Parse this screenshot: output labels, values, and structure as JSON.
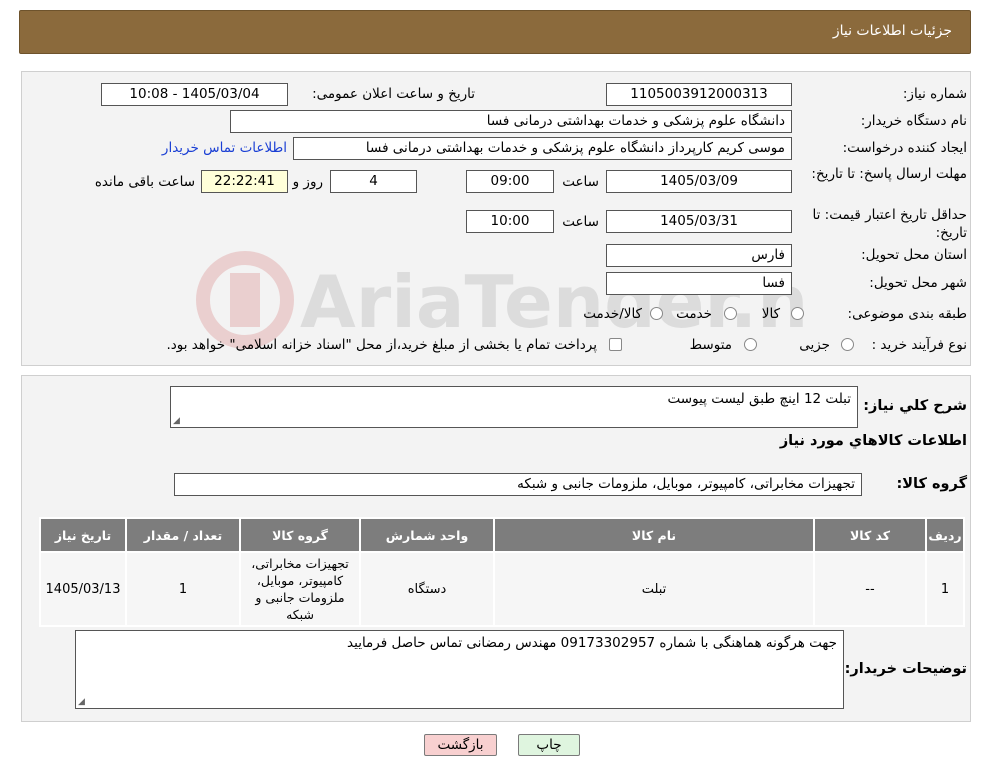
{
  "title": "جزئیات اطلاعات نیاز",
  "labels": {
    "need_number": "شماره نیاز:",
    "announce_datetime": "تاریخ و ساعت اعلان عمومی:",
    "buyer_org": "نام دستگاه خریدار:",
    "requester": "ایجاد کننده درخواست:",
    "send_deadline": "مهلت ارسال پاسخ: تا تاریخ:",
    "price_validity": "حداقل تاریخ اعتبار قیمت: تا تاریخ:",
    "province": "استان محل تحویل:",
    "city": "شهر محل تحویل:",
    "category": "طبقه بندی موضوعی:",
    "process_type": "نوع فرآیند خرید :",
    "time": "ساعت",
    "day_and": "روز و",
    "remaining": "ساعت باقی مانده",
    "description": "شرح کلي نياز:",
    "goods_info": "اطلاعات کالاهاي مورد نياز",
    "goods_group": "گروه کالا:",
    "buyer_notes": "توضیحات خریدار:"
  },
  "values": {
    "need_number": "1105003912000313",
    "announce_datetime": "1405/03/04 - 10:08",
    "buyer_org": "دانشگاه علوم پزشکی و خدمات بهداشتی درمانی فسا",
    "requester": "موسی کریم کارپرداز دانشگاه علوم پزشکی و خدمات بهداشتی درمانی فسا",
    "contact_link": "اطلاعات تماس خریدار",
    "send_date": "1405/03/09",
    "send_time": "09:00",
    "days": "4",
    "remaining_time": "22:22:41",
    "validity_date": "1405/03/31",
    "validity_time": "10:00",
    "province": "فارس",
    "city": "فسا",
    "description": "تبلت 12 اینچ طبق لیست پیوست",
    "goods_group": "تجهیزات مخابراتی، کامپیوتر، موبایل، ملزومات جانبی و شبکه",
    "buyer_notes": "جهت هرگونه هماهنگی با شماره 09173302957 مهندس رمضانی تماس حاصل فرمایید"
  },
  "category_options": [
    "کالا",
    "خدمت",
    "کالا/خدمت"
  ],
  "process_options": [
    "جزیی",
    "متوسط"
  ],
  "process_note": "پرداخت تمام یا بخشی از مبلغ خرید،از محل \"اسناد خزانه اسلامی\" خواهد بود.",
  "table": {
    "headers": [
      "ردیف",
      "کد کالا",
      "نام کالا",
      "واحد شمارش",
      "گروه کالا",
      "تعداد / مقدار",
      "تاریخ نیاز"
    ],
    "rows": [
      [
        "1",
        "--",
        "تبلت",
        "دستگاه",
        "تجهیزات مخابراتی، کامپیوتر، موبایل، ملزومات جانبی و شبکه",
        "1",
        "1405/03/13"
      ]
    ]
  },
  "buttons": {
    "print": "چاپ",
    "back": "بازگشت"
  },
  "watermark": "AriaTender.neT",
  "colors": {
    "header_bg": "#8b6a3c",
    "table_header": "#7d7d7d",
    "link": "#1a3fd4",
    "back_btn": "#f8d0d0",
    "print_btn": "#dff5df"
  }
}
